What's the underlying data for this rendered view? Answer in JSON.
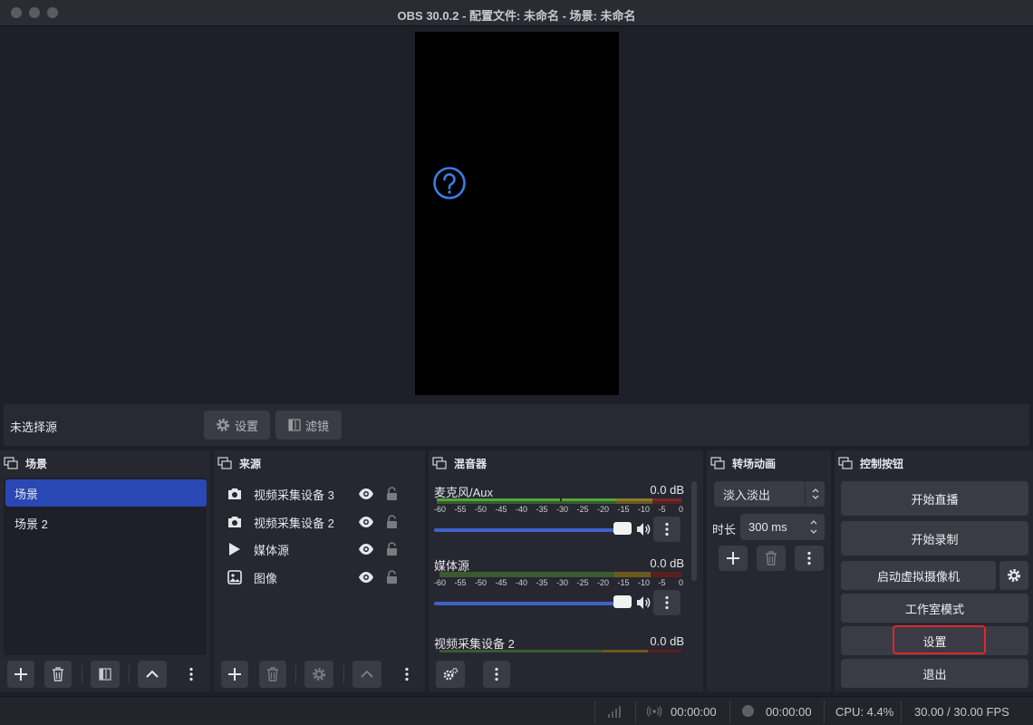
{
  "window": {
    "title": "OBS 30.0.2 - 配置文件: 未命名 - 场景: 未命名"
  },
  "source_toolbar": {
    "no_source": "未选择源",
    "settings_label": "设置",
    "filters_label": "滤镜"
  },
  "scenes": {
    "title": "场景",
    "items": [
      "场景",
      "场景 2"
    ],
    "selected_index": 0
  },
  "sources": {
    "title": "来源",
    "items": [
      {
        "name": "视频采集设备 3",
        "icon": "camera-icon"
      },
      {
        "name": "视频采集设备 2",
        "icon": "camera-icon"
      },
      {
        "name": "媒体源",
        "icon": "play-icon"
      },
      {
        "name": "图像",
        "icon": "image-icon"
      }
    ]
  },
  "mixer": {
    "title": "混音器",
    "channels": [
      {
        "name": "麦克风/Aux",
        "db": "0.0 dB",
        "fader": 1.0
      },
      {
        "name": "媒体源",
        "db": "0.0 dB",
        "fader": 1.0
      },
      {
        "name": "视频采集设备 2",
        "db": "0.0 dB",
        "fader": 1.0
      }
    ],
    "ticks": [
      "-60",
      "-55",
      "-50",
      "-45",
      "-40",
      "-35",
      "-30",
      "-25",
      "-20",
      "-15",
      "-10",
      "-5",
      "0"
    ]
  },
  "transitions": {
    "title": "转场动画",
    "selected": "淡入淡出",
    "duration_label": "时长",
    "duration_value": "300 ms"
  },
  "controls": {
    "title": "控制按钮",
    "start_stream": "开始直播",
    "start_record": "开始录制",
    "virtual_cam": "启动虚拟摄像机",
    "studio_mode": "工作室模式",
    "settings": "设置",
    "exit": "退出"
  },
  "status": {
    "stream_time": "00:00:00",
    "record_time": "00:00:00",
    "cpu": "CPU: 4.4%",
    "fps": "30.00 / 30.00 FPS"
  },
  "colors": {
    "accent": "#2a48b4",
    "highlight": "#e0272d",
    "meter_green": "#4fa83a"
  }
}
